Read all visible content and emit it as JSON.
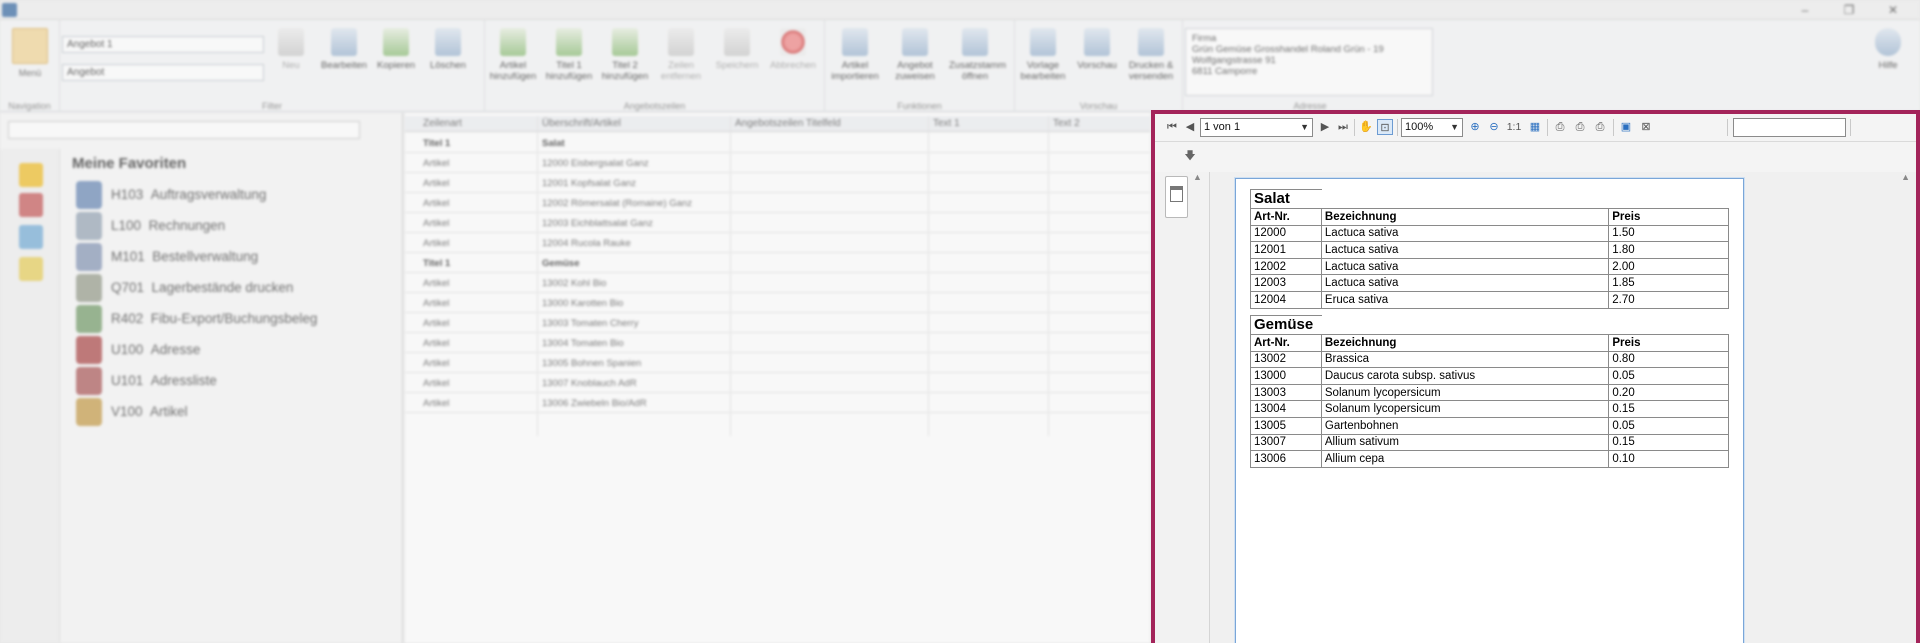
{
  "window": {
    "minimize": "–",
    "maximize": "❐",
    "close": "✕"
  },
  "ribbon": {
    "menu_label": "Menü",
    "filter_value": "Angebot 1",
    "filter_type": "Angebot",
    "groups": {
      "navigation": "Navigation",
      "filter": "Filter",
      "angebotszeilen": "Angebotszeilen",
      "funktionen": "Funktionen",
      "vorschau": "Vorschau",
      "adresse": "Adresse",
      "hilfe": "Hilfe"
    },
    "buttons": {
      "neu": "Neu",
      "bearbeiten": "Bearbeiten",
      "kopieren": "Kopieren",
      "loeschen": "Löschen",
      "artikel_hinzufuegen": "Artikel hinzufügen",
      "titel1_hinzufuegen": "Titel 1 hinzufügen",
      "titel2_hinzufuegen": "Titel 2 hinzufügen",
      "zeilen_entfernen": "Zeilen entfernen",
      "speichern": "Speichern",
      "abbrechen": "Abbrechen",
      "artikel_importieren": "Artikel importieren",
      "angebot_zuweisen": "Angebot zuweisen",
      "zusatzstamm_oeffnen": "Zusatzstamm öffnen",
      "vorlage_bearbeiten": "Vorlage bearbeiten",
      "vorschau": "Vorschau",
      "drucken_versenden": "Drucken & versenden",
      "hilfe": "Hilfe"
    },
    "firm": {
      "line1": "Firma",
      "line2": "Grün Gemüse Grosshandel Roland Grün - 19",
      "line3": "Wolfgangstrasse 91",
      "line4": "6811 Camporre"
    }
  },
  "sidebar": {
    "favorites_title": "Meine Favoriten",
    "items": [
      {
        "code": "H103",
        "label": "Auftragsverwaltung"
      },
      {
        "code": "L100",
        "label": "Rechnungen"
      },
      {
        "code": "M101",
        "label": "Bestellverwaltung"
      },
      {
        "code": "Q701",
        "label": "Lagerbestände drucken"
      },
      {
        "code": "R402",
        "label": "Fibu-Export/Buchungsbeleg"
      },
      {
        "code": "U100",
        "label": "Adresse"
      },
      {
        "code": "U101",
        "label": "Adressliste"
      },
      {
        "code": "V100",
        "label": "Artikel"
      }
    ]
  },
  "grid": {
    "columns": [
      "Zeilenart",
      "Überschrift/Artikel",
      "Angebotszeilen Titelfeld",
      "Text 1",
      "Text 2"
    ],
    "rows": [
      {
        "type": "Titel 1",
        "item": "Salat",
        "bold": true
      },
      {
        "type": "Artikel",
        "item": "12000 Eisbergsalat Ganz"
      },
      {
        "type": "Artikel",
        "item": "12001 Kopfsalat Ganz"
      },
      {
        "type": "Artikel",
        "item": "12002 Römersalat (Romaine) Ganz"
      },
      {
        "type": "Artikel",
        "item": "12003 Eichblattsalat Ganz"
      },
      {
        "type": "Artikel",
        "item": "12004 Rucola Rauke"
      },
      {
        "type": "Titel 1",
        "item": "Gemüse",
        "bold": true
      },
      {
        "type": "Artikel",
        "item": "13002 Kohl Bio"
      },
      {
        "type": "Artikel",
        "item": "13000 Karotten Bio"
      },
      {
        "type": "Artikel",
        "item": "13003 Tomaten Cherry"
      },
      {
        "type": "Artikel",
        "item": "13004 Tomaten Bio"
      },
      {
        "type": "Artikel",
        "item": "13005 Bohnen Spanien"
      },
      {
        "type": "Artikel",
        "item": "13007 Knoblauch AdR"
      },
      {
        "type": "Artikel",
        "item": "13006 Zwiebeln Bio/AdR"
      }
    ]
  },
  "preview": {
    "page_selector": "1 von 1",
    "zoom": "100%",
    "one_to_one": "1:1",
    "find_placeholder": "",
    "report": {
      "sections": [
        {
          "title": "Salat",
          "headers": [
            "Art-Nr.",
            "Bezeichnung",
            "Preis"
          ],
          "rows": [
            [
              "12000",
              "Lactuca sativa",
              "1.50"
            ],
            [
              "12001",
              "Lactuca sativa",
              "1.80"
            ],
            [
              "12002",
              "Lactuca sativa",
              "2.00"
            ],
            [
              "12003",
              "Lactuca sativa",
              "1.85"
            ],
            [
              "12004",
              "Eruca sativa",
              "2.70"
            ]
          ]
        },
        {
          "title": "Gemüse",
          "headers": [
            "Art-Nr.",
            "Bezeichnung",
            "Preis"
          ],
          "rows": [
            [
              "13002",
              "Brassica",
              "0.80"
            ],
            [
              "13000",
              "Daucus carota subsp. sativus",
              "0.05"
            ],
            [
              "13003",
              "Solanum lycopersicum",
              "0.20"
            ],
            [
              "13004",
              "Solanum lycopersicum",
              "0.15"
            ],
            [
              "13005",
              "Gartenbohnen",
              "0.05"
            ],
            [
              "13007",
              "Allium sativum",
              "0.15"
            ],
            [
              "13006",
              "Allium cepa",
              "0.10"
            ]
          ]
        }
      ]
    }
  },
  "colors": {
    "highlight_border": "#a3245a",
    "page_border": "#7aa6d8"
  }
}
